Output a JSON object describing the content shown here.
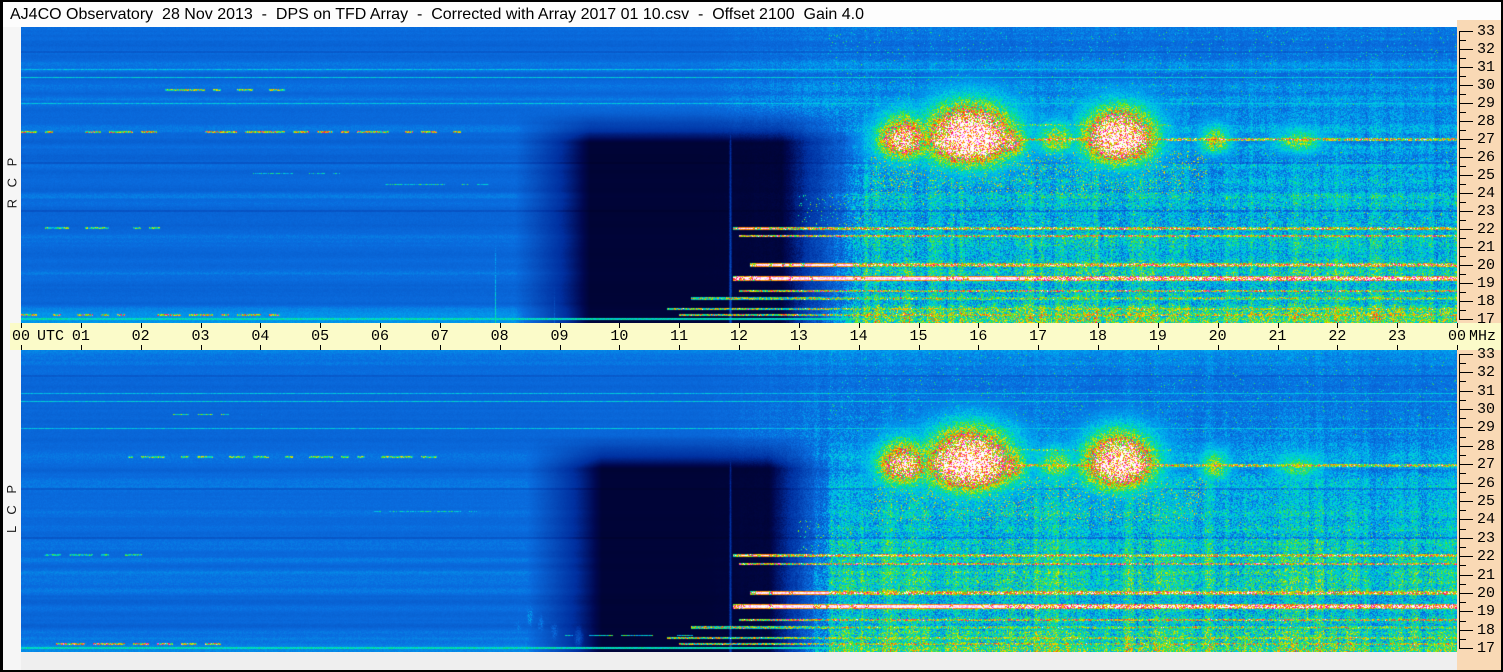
{
  "header": {
    "title": "AJ4CO Observatory  28 Nov 2013  -  DPS on TFD Array  -  Corrected with Array 2017 01 10.csv  -  Offset 2100  Gain 4.0"
  },
  "window": {
    "border_color": "#000000",
    "titlebar_bg": "#fdfdfd",
    "left_strip_bg": "#f6f6f6",
    "right_strip_bg": "#f9d9b5",
    "bottom_strip_bg": "#efefef",
    "title_color": "#000000"
  },
  "time_axis": {
    "band_bg": "#fbfbc9",
    "tick_color": "#000000",
    "text_color": "#000000",
    "unit_left": "UTC",
    "unit_right": "MHz",
    "hours": [
      "00",
      "01",
      "02",
      "03",
      "04",
      "05",
      "06",
      "07",
      "08",
      "09",
      "10",
      "11",
      "12",
      "13",
      "14",
      "15",
      "16",
      "17",
      "18",
      "19",
      "20",
      "21",
      "22",
      "23",
      "00"
    ]
  },
  "freq_axis": {
    "strip_bg": "#f9d9b5",
    "tick_color": "#000000",
    "text_color": "#000000",
    "major_ticks": [
      33,
      32,
      31,
      30,
      29,
      28,
      27,
      26,
      25,
      24,
      23,
      22,
      21,
      20,
      19,
      18,
      17
    ],
    "minor_step": 0.5
  },
  "chart_data": {
    "type": "heatmap",
    "title": "AJ4CO Observatory  28 Nov 2013  -  DPS on TFD Array  -  Corrected with Array 2017 01 10.csv  -  Offset 2100  Gain 4.0",
    "x": {
      "label": "UTC",
      "units": "hours",
      "range": [
        0,
        24
      ],
      "tick_labels": [
        "00",
        "01",
        "02",
        "03",
        "04",
        "05",
        "06",
        "07",
        "08",
        "09",
        "10",
        "11",
        "12",
        "13",
        "14",
        "15",
        "16",
        "17",
        "18",
        "19",
        "20",
        "21",
        "22",
        "23",
        "00"
      ]
    },
    "y": {
      "label": "MHz",
      "range": [
        16.8,
        33.2
      ],
      "orientation": "high-at-top",
      "tick_values": [
        33,
        32,
        31,
        30,
        29,
        28,
        27,
        26,
        25,
        24,
        23,
        22,
        21,
        20,
        19,
        18,
        17
      ]
    },
    "colormap": {
      "stops": [
        {
          "v": 0.0,
          "c": "#000014"
        },
        {
          "v": 0.08,
          "c": "#000850"
        },
        {
          "v": 0.18,
          "c": "#0030a0"
        },
        {
          "v": 0.3,
          "c": "#0750c0"
        },
        {
          "v": 0.42,
          "c": "#0a6ee0"
        },
        {
          "v": 0.5,
          "c": "#00aaf0"
        },
        {
          "v": 0.57,
          "c": "#00d8d8"
        },
        {
          "v": 0.64,
          "c": "#00e090"
        },
        {
          "v": 0.71,
          "c": "#80e800"
        },
        {
          "v": 0.78,
          "c": "#ffe000"
        },
        {
          "v": 0.84,
          "c": "#ff9000"
        },
        {
          "v": 0.89,
          "c": "#ff3020"
        },
        {
          "v": 0.93,
          "c": "#ff00b0"
        },
        {
          "v": 0.96,
          "c": "#ff60ff"
        },
        {
          "v": 1.0,
          "c": "#ffffff"
        }
      ]
    },
    "panels": [
      {
        "id": "rcp",
        "side_label": "R C P",
        "seed": 20131128,
        "dark_region": {
          "t0": 8.25,
          "t_full": 9.5,
          "t_hold": 12.7,
          "t_end": 14.1,
          "f_top_start": 28.6,
          "f_top_full": 26.8
        },
        "bright_region": {
          "t0": 11.3,
          "t_full": 13.3,
          "depth": [
            [
              16.8,
              0.74
            ],
            [
              19.5,
              0.66
            ],
            [
              24.0,
              0.54
            ],
            [
              25.5,
              0.42
            ],
            [
              28.5,
              0.27
            ],
            [
              30.5,
              0.15
            ],
            [
              33.2,
              0.1
            ]
          ]
        },
        "mountains": [
          {
            "t": 14.75,
            "wt": 0.5,
            "f": 26.9,
            "up": 1.6,
            "dn": 1.1,
            "a": 0.5
          },
          {
            "t": 15.85,
            "wt": 0.8,
            "f": 27.0,
            "up": 2.1,
            "dn": 1.5,
            "a": 0.66
          },
          {
            "t": 16.5,
            "wt": 0.35,
            "f": 26.8,
            "up": 1.4,
            "dn": 0.9,
            "a": 0.42
          },
          {
            "t": 17.3,
            "wt": 0.4,
            "f": 26.9,
            "up": 1.2,
            "dn": 0.8,
            "a": 0.3
          },
          {
            "t": 18.35,
            "wt": 0.65,
            "f": 27.0,
            "up": 1.9,
            "dn": 1.4,
            "a": 0.62
          },
          {
            "t": 19.95,
            "wt": 0.3,
            "f": 26.8,
            "up": 1.1,
            "dn": 0.7,
            "a": 0.3
          },
          {
            "t": 21.35,
            "wt": 0.45,
            "f": 26.8,
            "up": 0.9,
            "dn": 0.6,
            "a": 0.26
          }
        ],
        "speckles": [
          {
            "t0": 14.2,
            "t1": 19.8,
            "f0": 24.0,
            "f1": 26.3,
            "p": 0.1,
            "v": 0.72
          },
          {
            "t0": 13.0,
            "t1": 24.0,
            "f0": 22.3,
            "f1": 24.0,
            "p": 0.04,
            "v": 0.66
          },
          {
            "t0": 13.5,
            "t1": 24.0,
            "f0": 28.6,
            "f1": 33.0,
            "p": 0.02,
            "v": 0.6
          },
          {
            "t0": 19.5,
            "t1": 24.0,
            "f0": 24.5,
            "f1": 26.5,
            "p": 0.03,
            "v": 0.62
          }
        ],
        "streaks": [
          {
            "t": 7.93,
            "f0": 16.8,
            "f1": 26.3,
            "v": 0.62,
            "w": 2
          },
          {
            "t": 8.5,
            "f0": 16.8,
            "f1": 21.0,
            "v": 0.4,
            "w": 1
          },
          {
            "t": 8.9,
            "f0": 16.8,
            "f1": 20.0,
            "v": 0.37,
            "w": 1
          },
          {
            "t": 11.85,
            "f0": 16.8,
            "f1": 33.2,
            "v": 0.32,
            "w": 1
          },
          {
            "t": 18.1,
            "f0": 23.0,
            "f1": 33.2,
            "v": 0.35,
            "w": 1
          }
        ],
        "wisps": [],
        "dark_lines": [
          {
            "f": 25.7
          },
          {
            "f": 23.05
          },
          {
            "f": 31.85
          }
        ],
        "lines": [
          {
            "f": 30.85,
            "t0": 0,
            "t1": 24,
            "v": 0.53,
            "th": 1,
            "style": "solid"
          },
          {
            "f": 30.4,
            "t0": 0,
            "t1": 24,
            "v": 0.55,
            "th": 1,
            "style": "solid"
          },
          {
            "f": 28.95,
            "t0": 0,
            "t1": 24,
            "v": 0.54,
            "th": 1,
            "style": "solid"
          },
          {
            "f": 29.7,
            "t0": 1.5,
            "t1": 4.6,
            "v": 0.66,
            "th": 2,
            "style": "dashed"
          },
          {
            "f": 27.4,
            "t0": 0,
            "t1": 7.4,
            "v": 0.72,
            "th": 2,
            "style": "dashed"
          },
          {
            "f": 25.1,
            "t0": 3.8,
            "t1": 5.3,
            "v": 0.52,
            "th": 1,
            "style": "dashed"
          },
          {
            "f": 24.45,
            "t0": 6.1,
            "t1": 7.8,
            "v": 0.55,
            "th": 1,
            "style": "dashed"
          },
          {
            "f": 26.95,
            "t0": 14.4,
            "t1": 24,
            "v": 0.8,
            "th": 3,
            "style": "hot",
            "white": [
              15.4,
              16.2
            ]
          },
          {
            "f": 27.75,
            "t0": 14.5,
            "t1": 19.2,
            "v": 0.6,
            "th": 2,
            "style": "hot"
          },
          {
            "f": 22.05,
            "t0": 11.9,
            "t1": 24,
            "v": 0.85,
            "th": 3,
            "style": "hot",
            "white": [
              12.0,
              12.6
            ]
          },
          {
            "f": 22.05,
            "t0": 0.3,
            "t1": 2.3,
            "v": 0.6,
            "th": 2,
            "style": "dashed"
          },
          {
            "f": 21.6,
            "t0": 12.0,
            "t1": 24,
            "v": 0.78,
            "th": 2,
            "style": "hot"
          },
          {
            "f": 20.0,
            "t0": 12.2,
            "t1": 24,
            "v": 0.85,
            "th": 4,
            "style": "hot",
            "white": [
              12.3,
              13.9
            ]
          },
          {
            "f": 19.25,
            "t0": 11.9,
            "t1": 24,
            "v": 0.95,
            "th": 5,
            "style": "hot",
            "white": [
              12.1,
              16.9
            ]
          },
          {
            "f": 18.55,
            "t0": 12.0,
            "t1": 24,
            "v": 0.75,
            "th": 2,
            "style": "hot"
          },
          {
            "f": 18.15,
            "t0": 11.2,
            "t1": 24,
            "v": 0.7,
            "th": 3,
            "style": "hot"
          },
          {
            "f": 17.55,
            "t0": 10.8,
            "t1": 24,
            "v": 0.66,
            "th": 2,
            "style": "hot"
          },
          {
            "f": 17.25,
            "t0": 0,
            "t1": 4.3,
            "v": 0.74,
            "th": 2,
            "style": "dashed"
          },
          {
            "f": 17.25,
            "t0": 11.0,
            "t1": 24,
            "v": 0.7,
            "th": 2,
            "style": "hot"
          },
          {
            "f": 17.0,
            "t0": 0,
            "t1": 24,
            "v": 0.6,
            "th": 2,
            "style": "solid"
          }
        ]
      },
      {
        "id": "lcp",
        "side_label": "L C P",
        "seed": 20131129,
        "dark_region": {
          "t0": 8.45,
          "t_full": 9.7,
          "t_hold": 12.5,
          "t_end": 13.6,
          "f_top_start": 28.6,
          "f_top_full": 26.8
        },
        "bright_region": {
          "t0": 11.3,
          "t_full": 13.4,
          "depth": [
            [
              16.8,
              0.74
            ],
            [
              19.5,
              0.66
            ],
            [
              24.0,
              0.54
            ],
            [
              25.5,
              0.42
            ],
            [
              28.5,
              0.27
            ],
            [
              30.5,
              0.15
            ],
            [
              33.2,
              0.1
            ]
          ]
        },
        "mountains": [
          {
            "t": 14.75,
            "wt": 0.5,
            "f": 26.9,
            "up": 1.6,
            "dn": 1.1,
            "a": 0.48
          },
          {
            "t": 15.85,
            "wt": 0.8,
            "f": 27.0,
            "up": 2.1,
            "dn": 1.5,
            "a": 0.64
          },
          {
            "t": 16.5,
            "wt": 0.35,
            "f": 26.8,
            "up": 1.4,
            "dn": 0.9,
            "a": 0.4
          },
          {
            "t": 17.3,
            "wt": 0.4,
            "f": 26.9,
            "up": 1.2,
            "dn": 0.8,
            "a": 0.28
          },
          {
            "t": 18.35,
            "wt": 0.65,
            "f": 27.0,
            "up": 1.9,
            "dn": 1.4,
            "a": 0.6
          },
          {
            "t": 19.95,
            "wt": 0.3,
            "f": 26.8,
            "up": 1.1,
            "dn": 0.7,
            "a": 0.28
          },
          {
            "t": 21.35,
            "wt": 0.45,
            "f": 26.8,
            "up": 0.9,
            "dn": 0.6,
            "a": 0.24
          }
        ],
        "speckles": [
          {
            "t0": 14.2,
            "t1": 19.8,
            "f0": 24.0,
            "f1": 26.3,
            "p": 0.1,
            "v": 0.72
          },
          {
            "t0": 13.0,
            "t1": 24.0,
            "f0": 22.3,
            "f1": 24.0,
            "p": 0.04,
            "v": 0.66
          },
          {
            "t0": 13.5,
            "t1": 24.0,
            "f0": 28.6,
            "f1": 33.0,
            "p": 0.02,
            "v": 0.6
          },
          {
            "t0": 19.5,
            "t1": 24.0,
            "f0": 24.5,
            "f1": 26.5,
            "p": 0.03,
            "v": 0.62
          }
        ],
        "streaks": [
          {
            "t": 8.2,
            "f0": 16.8,
            "f1": 19.5,
            "v": 0.33,
            "w": 1
          },
          {
            "t": 11.85,
            "f0": 16.8,
            "f1": 33.2,
            "v": 0.28,
            "w": 1
          },
          {
            "t": 18.1,
            "f0": 23.0,
            "f1": 33.2,
            "v": 0.3,
            "w": 1
          }
        ],
        "wisps": [
          {
            "t": 8.3,
            "f": 18.2,
            "wt": 0.12,
            "hf": 0.9,
            "a": 0.3
          },
          {
            "t": 8.5,
            "f": 18.8,
            "wt": 0.1,
            "hf": 1.1,
            "a": 0.34
          },
          {
            "t": 8.68,
            "f": 18.3,
            "wt": 0.09,
            "hf": 1.0,
            "a": 0.3
          },
          {
            "t": 8.9,
            "f": 17.9,
            "wt": 0.1,
            "hf": 0.8,
            "a": 0.26
          },
          {
            "t": 9.3,
            "f": 17.6,
            "wt": 0.08,
            "hf": 0.6,
            "a": 0.2
          }
        ],
        "dark_lines": [
          {
            "f": 25.7
          },
          {
            "f": 23.05
          },
          {
            "f": 31.85
          }
        ],
        "lines": [
          {
            "f": 30.85,
            "t0": 0,
            "t1": 24,
            "v": 0.53,
            "th": 1,
            "style": "solid"
          },
          {
            "f": 30.4,
            "t0": 0,
            "t1": 24,
            "v": 0.55,
            "th": 1,
            "style": "solid"
          },
          {
            "f": 28.95,
            "t0": 0,
            "t1": 24,
            "v": 0.54,
            "th": 1,
            "style": "solid"
          },
          {
            "f": 29.7,
            "t0": 2.0,
            "t1": 4.0,
            "v": 0.6,
            "th": 1,
            "style": "dashed"
          },
          {
            "f": 27.4,
            "t0": 1.8,
            "t1": 7.2,
            "v": 0.62,
            "th": 2,
            "style": "dashed"
          },
          {
            "f": 24.45,
            "t0": 5.9,
            "t1": 7.6,
            "v": 0.52,
            "th": 1,
            "style": "dashed"
          },
          {
            "f": 26.95,
            "t0": 14.4,
            "t1": 24,
            "v": 0.8,
            "th": 3,
            "style": "hot",
            "white": [
              15.3,
              16.1
            ]
          },
          {
            "f": 27.75,
            "t0": 14.5,
            "t1": 19.2,
            "v": 0.58,
            "th": 2,
            "style": "hot"
          },
          {
            "f": 22.05,
            "t0": 11.9,
            "t1": 24,
            "v": 0.85,
            "th": 3,
            "style": "hot",
            "white": [
              12.0,
              12.5
            ]
          },
          {
            "f": 22.05,
            "t0": 0.4,
            "t1": 2.0,
            "v": 0.55,
            "th": 2,
            "style": "dashed"
          },
          {
            "f": 21.6,
            "t0": 12.0,
            "t1": 24,
            "v": 0.78,
            "th": 2,
            "style": "hot"
          },
          {
            "f": 20.0,
            "t0": 12.2,
            "t1": 24,
            "v": 0.85,
            "th": 4,
            "style": "hot",
            "white": [
              12.3,
              13.6
            ]
          },
          {
            "f": 19.25,
            "t0": 11.9,
            "t1": 24,
            "v": 0.95,
            "th": 5,
            "style": "hot",
            "white": [
              12.1,
              16.5
            ]
          },
          {
            "f": 18.55,
            "t0": 12.0,
            "t1": 24,
            "v": 0.75,
            "th": 2,
            "style": "hot"
          },
          {
            "f": 18.15,
            "t0": 11.2,
            "t1": 24,
            "v": 0.7,
            "th": 3,
            "style": "hot"
          },
          {
            "f": 17.7,
            "t0": 7.9,
            "t1": 11.2,
            "v": 0.56,
            "th": 1,
            "style": "dashed"
          },
          {
            "f": 17.55,
            "t0": 10.8,
            "t1": 24,
            "v": 0.66,
            "th": 2,
            "style": "hot"
          },
          {
            "f": 17.25,
            "t0": 0.6,
            "t1": 3.4,
            "v": 0.76,
            "th": 2,
            "style": "dashed"
          },
          {
            "f": 17.25,
            "t0": 11.0,
            "t1": 24,
            "v": 0.7,
            "th": 2,
            "style": "hot"
          },
          {
            "f": 17.0,
            "t0": 0,
            "t1": 24,
            "v": 0.6,
            "th": 2,
            "style": "solid"
          }
        ]
      }
    ]
  }
}
